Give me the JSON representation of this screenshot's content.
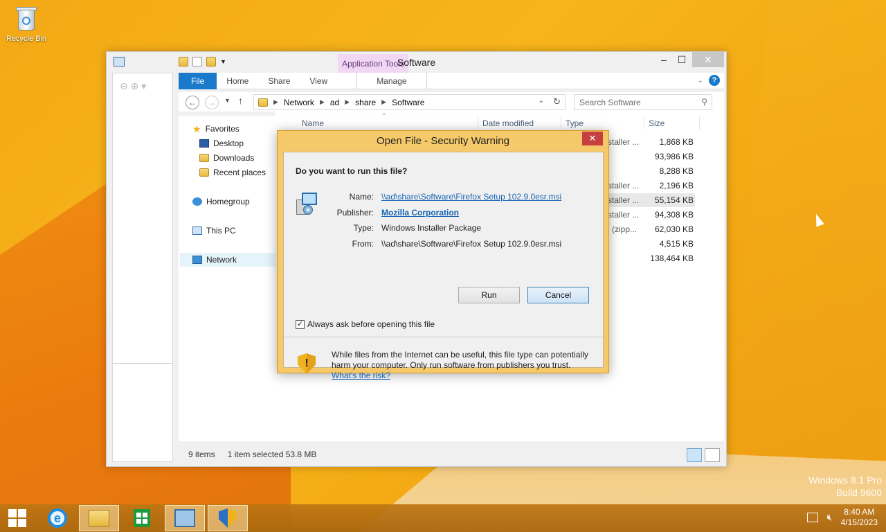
{
  "desktop": {
    "recycle_bin_label": "Recycle Bin",
    "watermark_line1": "Windows 8.1 Pro",
    "watermark_line2": "Build 9600"
  },
  "explorer": {
    "title": "Software",
    "context_tab": "Application Tools",
    "ribbon_tabs": [
      "File",
      "Home",
      "Share",
      "View",
      "Manage"
    ],
    "breadcrumb": [
      "Network",
      "ad",
      "share",
      "Software"
    ],
    "search_placeholder": "Search Software",
    "nav_pane": {
      "favorites": "Favorites",
      "desktop": "Desktop",
      "downloads": "Downloads",
      "recent": "Recent places",
      "homegroup": "Homegroup",
      "this_pc": "This PC",
      "network": "Network"
    },
    "columns": {
      "name": "Name",
      "date": "Date modified",
      "type": "Type",
      "size": "Size"
    },
    "rows": [
      {
        "type": "staller ...",
        "size": "1,868 KB"
      },
      {
        "type": "",
        "size": "93,986 KB"
      },
      {
        "type": "",
        "size": "8,288 KB"
      },
      {
        "type": "staller ...",
        "size": "2,196 KB"
      },
      {
        "type": "staller ...",
        "size": "55,154 KB"
      },
      {
        "type": "staller ...",
        "size": "94,308 KB"
      },
      {
        "type": "l (zipp...",
        "size": "62,030 KB"
      },
      {
        "type": "",
        "size": "4,515 KB"
      },
      {
        "type": "",
        "size": "138,464 KB"
      }
    ],
    "status": {
      "items": "9 items",
      "selected": "1 item selected  53.8 MB"
    }
  },
  "dialog": {
    "title": "Open File - Security Warning",
    "close_glyph": "✕",
    "question": "Do you want to run this file?",
    "labels": {
      "name": "Name:",
      "publisher": "Publisher:",
      "type": "Type:",
      "from": "From:"
    },
    "values": {
      "name": "\\\\ad\\share\\Software\\Firefox Setup 102.9.0esr.msi",
      "publisher": "Mozilla Corporation",
      "type": "Windows Installer Package",
      "from": "\\\\ad\\share\\Software\\Firefox Setup 102.9.0esr.msi"
    },
    "run_label": "Run",
    "cancel_label": "Cancel",
    "checkbox_label": "Always ask before opening this file",
    "checkbox_checked": true,
    "warning_text": "While files from the Internet can be useful, this file type can potentially harm your computer. Only run software from publishers you trust.",
    "risk_link": "What's the risk?"
  },
  "taskbar": {
    "time": "8:40 AM",
    "date": "4/15/2023"
  },
  "icons": [
    "recycle-bin-icon",
    "folder-icon",
    "properties-icon",
    "back-icon",
    "forward-icon",
    "up-arrow-icon",
    "refresh-icon",
    "search-icon",
    "help-icon",
    "package-icon",
    "shield-warning-icon",
    "windows-logo-icon",
    "ie-icon",
    "file-explorer-icon",
    "store-icon",
    "control-panel-icon",
    "uac-shield-icon",
    "network-tray-icon",
    "volume-muted-icon"
  ],
  "colors": {
    "accent": "#1979ca",
    "dialog_frame": "#f5c969",
    "link": "#1664b5",
    "desktop": "#f3a915"
  }
}
